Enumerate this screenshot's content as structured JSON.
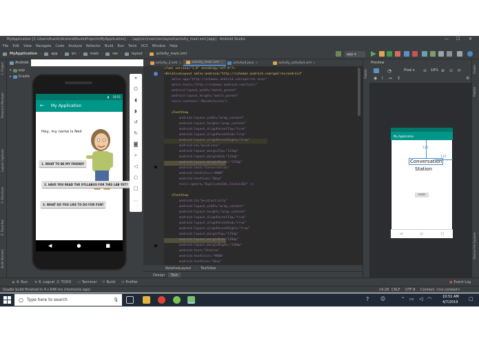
{
  "window": {
    "title": "MyApplication [C:\\Users\\Austin\\AndroidStudioProjects\\MyApplication] - ...\\app\\src\\main\\res\\layout\\activity_main.xml [app] - Android Studio"
  },
  "menu": [
    "File",
    "Edit",
    "View",
    "Navigate",
    "Code",
    "Analyze",
    "Refactor",
    "Build",
    "Run",
    "Tools",
    "VCS",
    "Window",
    "Help"
  ],
  "breadcrumb": [
    "MyApplication",
    "app",
    "src",
    "main",
    "res",
    "layout",
    "activity_main.xml"
  ],
  "toolbar": {
    "run_config": "app"
  },
  "project_panel": {
    "view_mode": "Android",
    "items": [
      "app",
      "Gradle S"
    ]
  },
  "left_strip_labels": [
    "1: Project",
    "Resource Manager",
    "Layout Captures",
    "2: Structure",
    "Z: Favorites",
    "Build Variants"
  ],
  "emulator": {
    "status_time": "10:51",
    "app_title": "My Application",
    "greeting": "Hey, my name is Neil",
    "buttons": [
      "1. WHAT TO BE MY FRIEND?",
      "2. HAVE YOU READ THE SYLLABUS FOR THIS LAB YET?",
      "3. WHAT DO YOU LIKE TO DO FOR FUN?"
    ]
  },
  "editor": {
    "tabs": [
      "activity_2.xml",
      "activity_main.xml",
      "activity4.java",
      "activity_activity4.xml"
    ],
    "active_tab": "activity_main.xml",
    "lines": [
      "<?xml version=\"1.0\" encoding=\"utf-8\"?>",
      "<RelativeLayout xmlns:android=\"http://schemas.android.com/apk/res/android\"",
      "    xmlns:app=\"http://schemas.android.com/apk/res-auto\"",
      "    xmlns:tools=\"http://schemas.android.com/tools\"",
      "    android:layout_width=\"match_parent\"",
      "    android:layout_height=\"match_parent\"",
      "    tools:context=\".MainActivity\">",
      "",
      "    <TextView",
      "        android:layout_width=\"wrap_content\"",
      "        android:layout_height=\"wrap_content\"",
      "        android:layout_alignParentTop=\"true\"",
      "        android:layout_alignParentEnd=\"true\"",
      "        android:layout_alignParentRight=\"true\"",
      "        android:id=\"@+id/conv\"",
      "        android:layout_marginTop=\"123dp\"",
      "        android:layout_marginEnd=\"115dp\"",
      "        android:layout_marginRight=\"115dp\"",
      "        android:text=\"Conversation\"",
      "        android:textColor=\"#000\"",
      "        android:textSize=\"30sp\"",
      "        tools:ignore=\"DuplicateIds,InvalidId\" />",
      "",
      "    <TextView",
      "        android:id=\"@+id/activity\"",
      "        android:layout_width=\"wrap_content\"",
      "        android:layout_height=\"wrap_content\"",
      "        android:layout_alignParentTop=\"true\"",
      "        android:layout_alignParentEnd=\"true\"",
      "        android:layout_alignParentRight=\"true\"",
      "        android:layout_marginTop=\"175dp\"",
      "        android:layout_marginEnd=\"150dp\"",
      "        android:layout_marginRight=\"150dp\"",
      "        android:text=\"Station\"",
      "        android:textColor=\"#000\"",
      "        android:textSize=\"30sp\"",
      "        tools:ignore=\"InvalidId\" />"
    ],
    "bottom_breadcrumb": [
      "RelativeLayout",
      "TextView"
    ],
    "design_tabs": [
      "Design",
      "Text"
    ],
    "active_design_tab": "Text"
  },
  "preview": {
    "title": "Preview",
    "device": "Pixel",
    "zoom": "18%",
    "app_title": "My Application",
    "text1": "Conversation",
    "text2": "Station",
    "button": "START",
    "margin_top_label": "123",
    "margin_end_label": "115"
  },
  "right_strip_labels": [
    "Gradle",
    "Palette",
    "Device File Explorer"
  ],
  "tool_windows": [
    "4: Run",
    "6: Logcat",
    "TODO",
    "Terminal",
    "Build",
    "Profiler"
  ],
  "event_log": "Event Log",
  "status": {
    "message": "Gradle build finished in 4 s 648 ms (moments ago)",
    "position": "14:28",
    "line_sep": "CRLF",
    "encoding": "UTF-8",
    "context": "Context: <no context>"
  },
  "taskbar": {
    "search_placeholder": "Type here to search",
    "time": "10:51 AM",
    "date": "4/7/2019"
  }
}
